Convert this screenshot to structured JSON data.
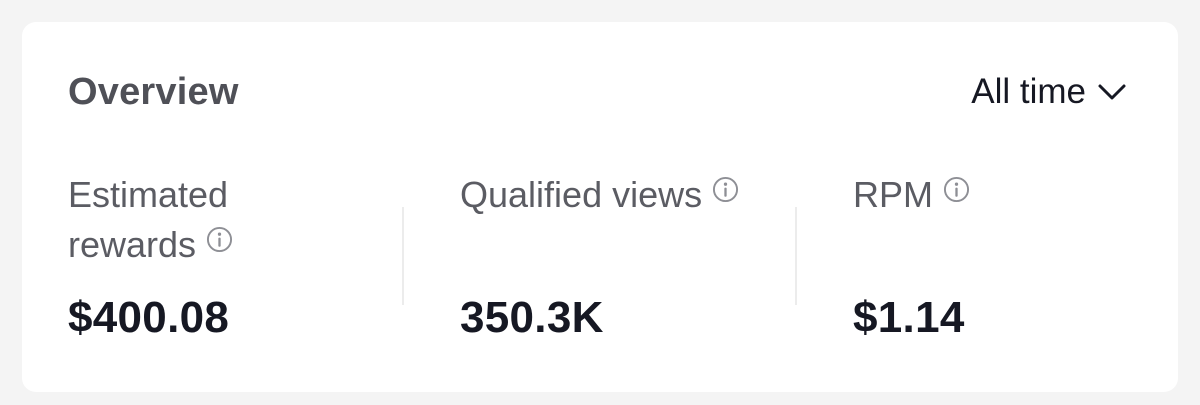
{
  "overview": {
    "title": "Overview",
    "period": {
      "selected": "All time"
    },
    "metrics": [
      {
        "label_line1": "Estimated",
        "label_line2": "rewards",
        "value": "$400.08",
        "info_icon": "info-icon"
      },
      {
        "label": "Qualified views",
        "value": "350.3K",
        "info_icon": "info-icon"
      },
      {
        "label": "RPM",
        "value": "$1.14",
        "info_icon": "info-icon"
      }
    ]
  },
  "colors": {
    "page_background": "#f4f4f4",
    "card_background": "#ffffff",
    "title_text": "#4f5057",
    "label_text": "#5b5c63",
    "value_text": "#161823",
    "icon_gray": "#8e8f95",
    "divider": "#ececec"
  }
}
